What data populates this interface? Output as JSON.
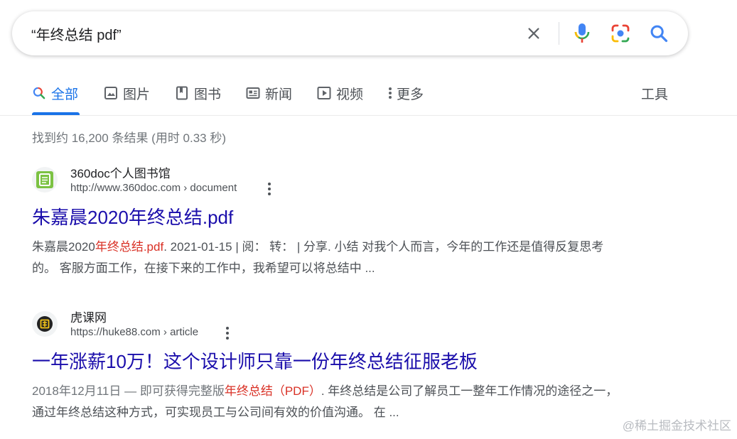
{
  "search": {
    "query": "“年终总结 pdf”",
    "clear_icon": "close-icon",
    "voice_icon": "microphone-icon",
    "lens_icon": "google-lens-icon",
    "search_icon": "search-icon"
  },
  "tabs": [
    {
      "label": "全部",
      "icon": "search-icon",
      "active": true
    },
    {
      "label": "图片",
      "icon": "image-icon"
    },
    {
      "label": "图书",
      "icon": "book-icon"
    },
    {
      "label": "新闻",
      "icon": "news-icon"
    },
    {
      "label": "视频",
      "icon": "play-icon"
    },
    {
      "label": "更多",
      "icon": "more-vert-icon"
    }
  ],
  "tools_label": "工具",
  "stats": "找到约 16,200 条结果  (用时 0.33 秒)",
  "results": [
    {
      "site_name": "360doc个人图书馆",
      "url": "http://www.360doc.com › document",
      "title": "朱嘉晨2020年终总结.pdf",
      "snippet_pre": "朱嘉晨2020",
      "snippet_hl": "年终总结.pdf",
      "snippet_post": ". 2021-01-15 | 阅：  转：  | 分享. 小结 对我个人而言，今年的工作还是值得反复思考的。 客服方面工作，在接下来的工作中，我希望可以将总结中 ..."
    },
    {
      "site_name": "虎课网",
      "url": "https://huke88.com › article",
      "title": "一年涨薪10万！这个设计师只靠一份年终总结征服老板",
      "snippet_date": "2018年12月11日 — 即可获得完整版",
      "snippet_hl": "年终总结（PDF）",
      "snippet_post": ". 年终总结是公司了解员工一整年工作情况的途径之一，通过年终总结这种方式，可实现员工与公司间有效的价值沟通。 在 ..."
    }
  ],
  "watermark": "@稀土掘金技术社区",
  "colors": {
    "link": "#1a0dab",
    "active_tab": "#1a73e8",
    "highlight": "#d93025",
    "text_secondary": "#4d5156"
  }
}
